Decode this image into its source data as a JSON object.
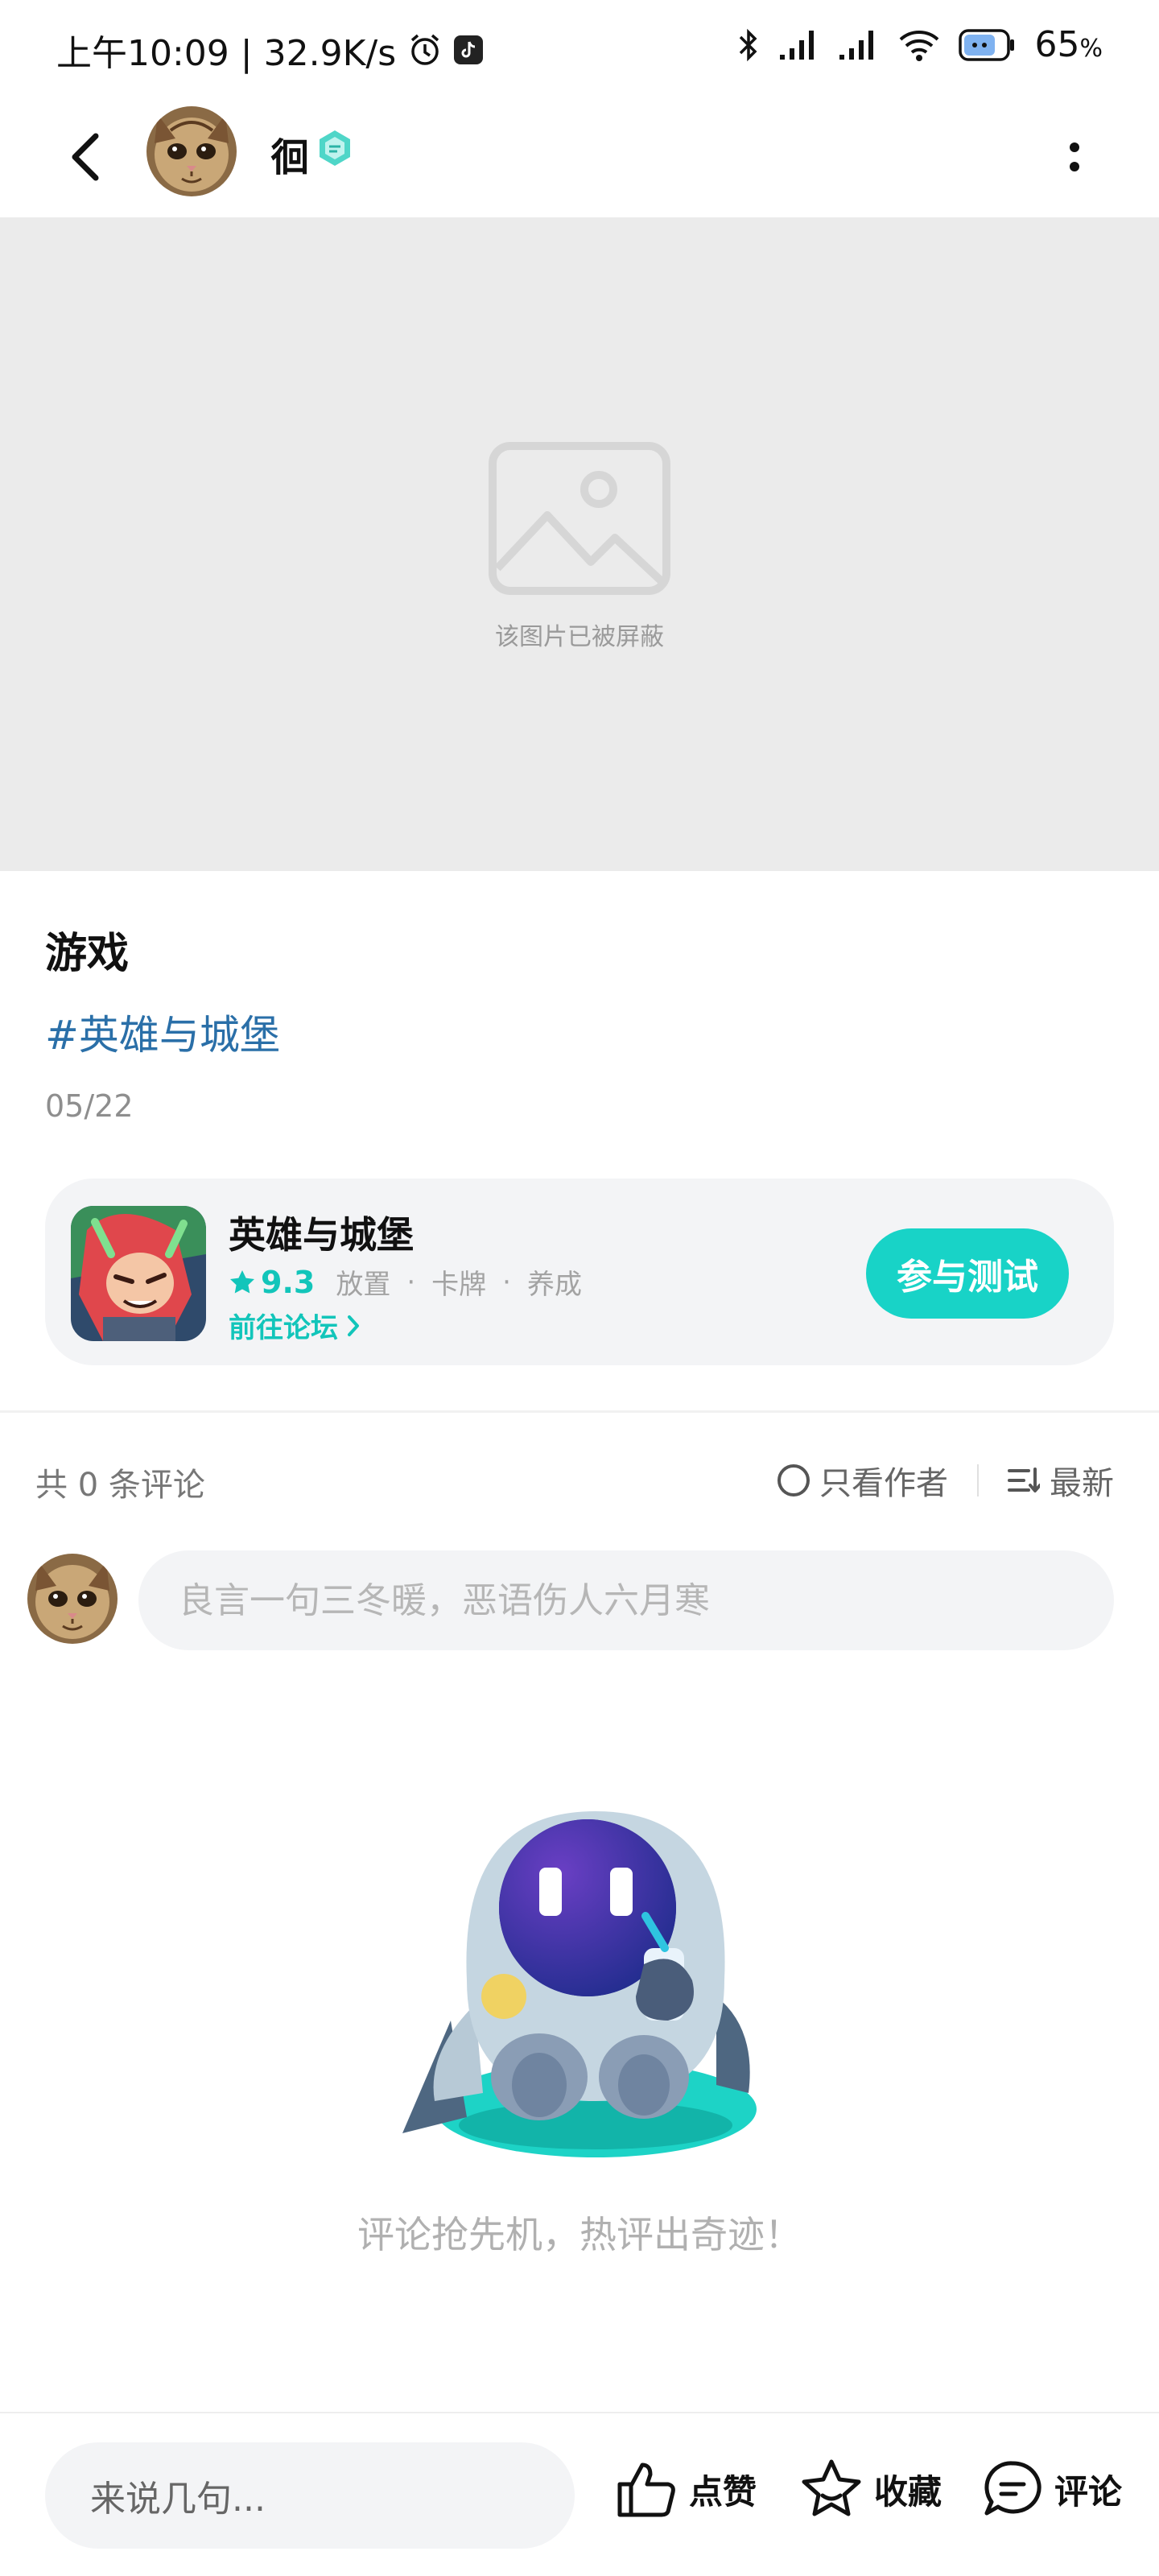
{
  "status_bar": {
    "time_speed": "上午10:09 | 32.9K/s",
    "battery": "65"
  },
  "header": {
    "username": "徊"
  },
  "image": {
    "blocked_text": "该图片已被屏蔽"
  },
  "post": {
    "title": "游戏",
    "tag": "#英雄与城堡",
    "date": "05/22"
  },
  "game_card": {
    "name": "英雄与城堡",
    "rating": "9.3",
    "genres": [
      "放置",
      "卡牌",
      "养成"
    ],
    "forum_link": "前往论坛",
    "join_button": "参与测试"
  },
  "comments": {
    "count_label": "共 0 条评论",
    "only_author": "只看作者",
    "sort": "最新",
    "input_placeholder": "良言一句三冬暖，恶语伤人六月寒",
    "empty_text": "评论抢先机，热评出奇迹！"
  },
  "bottom_bar": {
    "input_placeholder": "来说几句...",
    "like": "点赞",
    "favorite": "收藏",
    "comment": "评论"
  },
  "colors": {
    "accent": "#18d3c7",
    "tag": "#2a6fa8"
  }
}
